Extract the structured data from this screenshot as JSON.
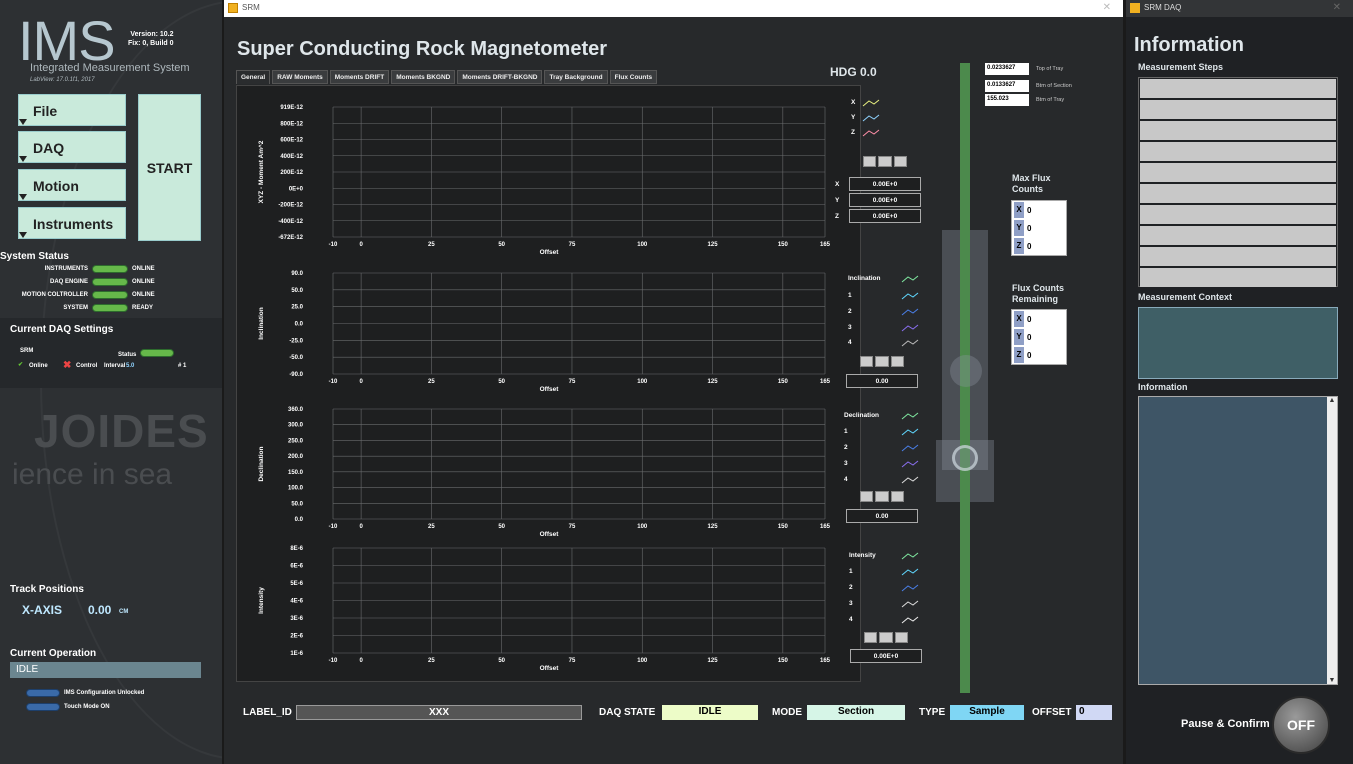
{
  "ims": {
    "logo": "IMS",
    "version": "Version: 10.2",
    "fix": "Fix: 0, Build 0",
    "subtitle": "Integrated Measurement System",
    "labview": "LabView: 17.0.1f1, 2017",
    "menu": [
      "File",
      "DAQ",
      "Motion",
      "Instruments"
    ],
    "start": "START",
    "system_status_title": "System Status",
    "system_status": [
      {
        "label": "INSTRUMENTS",
        "value": "ONLINE"
      },
      {
        "label": "DAQ ENGINE",
        "value": "ONLINE"
      },
      {
        "label": "MOTION COLTROLLER",
        "value": "ONLINE"
      },
      {
        "label": "SYSTEM",
        "value": "READY"
      }
    ],
    "daq_settings_title": "Current DAQ Settings",
    "daq_name": "SRM",
    "status_label": "Status",
    "online_label": "Online",
    "control_label": "Control",
    "interval_label": "Interval",
    "interval_value": "5.0",
    "count": "# 1",
    "watermark1": "JOIDES",
    "watermark2": "ience in sea",
    "track_positions_title": "Track Positions",
    "x_axis_label": "X-AXIS",
    "x_axis_value": "0.00",
    "x_axis_unit": "CM",
    "current_operation_title": "Current Operation",
    "current_operation": "IDLE",
    "toggle1": "IMS Configuration Unlocked",
    "toggle2": "Touch Mode ON"
  },
  "srm": {
    "window_title": "SRM",
    "title": "Super Conducting Rock Magnetometer",
    "tabs": [
      "General",
      "RAW Moments",
      "Moments DRIFT",
      "Moments BKGND",
      "Moments DRIFT-BKGND",
      "Tray Background",
      "Flux Counts"
    ],
    "hdg": "HDG 0.0",
    "offset_label": "Offset",
    "plot1": {
      "ylabel": "XYZ - Moment Am^2",
      "yticks": [
        "919E-12",
        "800E-12",
        "600E-12",
        "400E-12",
        "200E-12",
        "0E+0",
        "-200E-12",
        "-400E-12",
        "-672E-12"
      ],
      "legend": [
        "X",
        "Y",
        "Z"
      ],
      "readouts": [
        {
          "k": "X",
          "v": "0.00E+0"
        },
        {
          "k": "Y",
          "v": "0.00E+0"
        },
        {
          "k": "Z",
          "v": "0.00E+0"
        }
      ]
    },
    "plot2": {
      "ylabel": "Inclination",
      "yticks": [
        "90.0",
        "50.0",
        "25.0",
        "0.0",
        "-25.0",
        "-50.0",
        "-90.0"
      ],
      "legend": [
        "Inclination",
        "1",
        "2",
        "3",
        "4"
      ],
      "readout": "0.00"
    },
    "plot3": {
      "ylabel": "Declination",
      "yticks": [
        "360.0",
        "300.0",
        "250.0",
        "200.0",
        "150.0",
        "100.0",
        "50.0",
        "0.0"
      ],
      "legend": [
        "Declination",
        "1",
        "2",
        "3",
        "4"
      ],
      "readout": "0.00"
    },
    "plot4": {
      "ylabel": "Intensity",
      "yticks": [
        "8E-6",
        "6E-6",
        "5E-6",
        "4E-6",
        "3E-6",
        "2E-6",
        "1E-6"
      ],
      "legend": [
        "Intensity",
        "1",
        "2",
        "3",
        "4"
      ],
      "readout": "0.00E+0"
    },
    "xticks": [
      "-10",
      "0",
      "25",
      "50",
      "75",
      "100",
      "125",
      "150",
      "165"
    ],
    "tray": [
      {
        "value": "0.0233627",
        "label": "Top of Tray"
      },
      {
        "value": "0.0133627",
        "label": "Btm of Section"
      },
      {
        "value": "155.023",
        "label": "Btm of Tray"
      }
    ],
    "max_flux_title1": "Max Flux",
    "max_flux_title2": "Counts",
    "max_flux": [
      {
        "k": "X",
        "v": "0"
      },
      {
        "k": "Y",
        "v": "0"
      },
      {
        "k": "Z",
        "v": "0"
      }
    ],
    "flux_rem_title1": "Flux Counts",
    "flux_rem_title2": "Remaining",
    "flux_remaining": [
      {
        "k": "X",
        "v": "0"
      },
      {
        "k": "Y",
        "v": "0"
      },
      {
        "k": "Z",
        "v": "0"
      }
    ],
    "label_id_label": "LABEL_ID",
    "label_id_value": "XXX",
    "daq_state_label": "DAQ STATE",
    "daq_state_value": "IDLE",
    "mode_label": "MODE",
    "mode_value": "Section",
    "type_label": "TYPE",
    "type_value": "Sample",
    "offset_field_label": "OFFSET",
    "offset_value": "0"
  },
  "info": {
    "window_title": "SRM DAQ",
    "title": "Information",
    "steps_title": "Measurement Steps",
    "context_title": "Measurement Context",
    "info_title": "Information",
    "pause_label": "Pause & Confirm",
    "off_label": "OFF"
  }
}
